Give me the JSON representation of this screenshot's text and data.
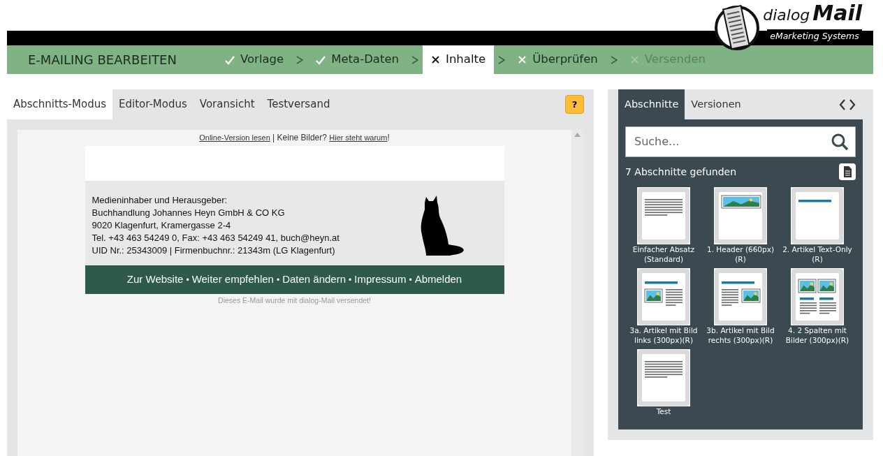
{
  "logo": {
    "word_1": "dialog",
    "word_2": "Mail",
    "tagline": "eMarketing Systems"
  },
  "wizard": {
    "title": "E-MAILING BEARBEITEN",
    "steps": [
      {
        "label": "Vorlage",
        "done": true,
        "selected": false,
        "disabled": false
      },
      {
        "label": "Meta-Daten",
        "done": true,
        "selected": false,
        "disabled": false
      },
      {
        "label": "Inhalte",
        "done": false,
        "selected": true,
        "disabled": false
      },
      {
        "label": "Überprüfen",
        "done": false,
        "selected": false,
        "disabled": false
      },
      {
        "label": "Versenden",
        "done": false,
        "selected": false,
        "disabled": true
      }
    ]
  },
  "editor": {
    "tabs": [
      {
        "label": "Abschnitts-Modus",
        "selected": true
      },
      {
        "label": "Editor-Modus",
        "selected": false
      },
      {
        "label": "Voransicht",
        "selected": false
      },
      {
        "label": "Testversand",
        "selected": false
      }
    ],
    "help_button": "?",
    "preview": {
      "notice": [
        {
          "kind": "link",
          "text": "Online-Version lesen"
        },
        {
          "kind": "text",
          "text": " | Keine Bilder? "
        },
        {
          "kind": "link",
          "text": "Hier steht warum"
        },
        {
          "kind": "text",
          "text": "!"
        }
      ],
      "imprint": [
        "Medieninhaber und Herausgeber:",
        "Buchhandlung Johannes Heyn GmbH & CO KG",
        "9020 Klagenfurt, Kramergasse 2-4",
        "Tel. +43 463 54249 0, Fax: +43 463 54249 41, buch@heyn.at",
        "UID Nr.: 25343009 | Firmenbuchnr.: 21343m (LG Klagenfurt)"
      ],
      "footer_links": [
        {
          "text": "Zur Website"
        },
        {
          "prefix": "•",
          "text": "Weiter empfehlen"
        },
        {
          "prefix": "•",
          "text": "Daten ändern"
        },
        {
          "prefix": "•",
          "text": "Impressum"
        },
        {
          "prefix": "•",
          "text": "Abmelden"
        }
      ],
      "sent_note": "Dieses E-Mail wurde mit dialog-Mail versendet!"
    }
  },
  "sections_panel": {
    "tabs": [
      {
        "label": "Abschnitte",
        "selected": true
      },
      {
        "label": "Versionen",
        "selected": false
      }
    ],
    "search": {
      "placeholder": "Suche..."
    },
    "count": "7 Abschnitte gefunden",
    "items": [
      {
        "kind": "text",
        "label": "Einfacher Absatz (Standard)"
      },
      {
        "kind": "header",
        "label": "1. Header (660px) (R)"
      },
      {
        "kind": "title",
        "label": "2. Artikel Text-Only (R)"
      },
      {
        "kind": "image-left",
        "label": "3a. Artikel mit Bild links (300px)(R)"
      },
      {
        "kind": "image-right",
        "label": "3b. Artikel mit Bild rechts (300px)(R)"
      },
      {
        "kind": "two-columns",
        "label": "4. 2 Spalten mit Bilder (300px)(R)"
      },
      {
        "kind": "text",
        "label": "Test"
      }
    ]
  }
}
